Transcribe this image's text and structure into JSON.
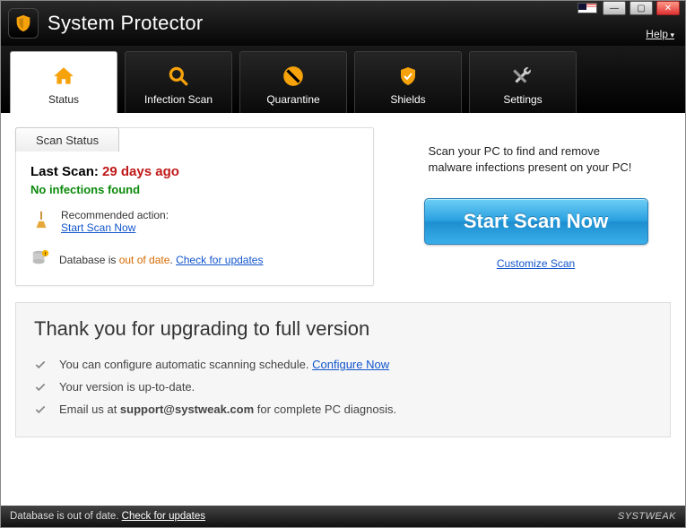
{
  "app": {
    "title": "System Protector",
    "help": "Help"
  },
  "tabs": [
    {
      "label": "Status"
    },
    {
      "label": "Infection Scan"
    },
    {
      "label": "Quarantine"
    },
    {
      "label": "Shields"
    },
    {
      "label": "Settings"
    }
  ],
  "scan": {
    "tab_label": "Scan Status",
    "last_scan_label": "Last Scan:",
    "last_scan_value": "29 days ago",
    "no_infections": "No infections found",
    "recommended_label": "Recommended action:",
    "start_scan_link": "Start Scan Now",
    "db_prefix": "Database is ",
    "db_status": "out of date",
    "db_dot": ". ",
    "check_updates": "Check for updates"
  },
  "side": {
    "desc": "Scan your PC to find and remove malware infections present on your PC!",
    "button": "Start Scan Now",
    "customize": "Customize Scan"
  },
  "upgrade": {
    "title": "Thank you for upgrading to full version",
    "line1a": "You can configure automatic scanning schedule. ",
    "line1b": "Configure Now",
    "line2": "Your version is up-to-date.",
    "line3a": "Email us at ",
    "line3b": "support@systweak.com",
    "line3c": " for complete PC diagnosis."
  },
  "statusbar": {
    "text": "Database is out of date. ",
    "link": "Check for updates",
    "brand": "SYSTWEAK"
  }
}
